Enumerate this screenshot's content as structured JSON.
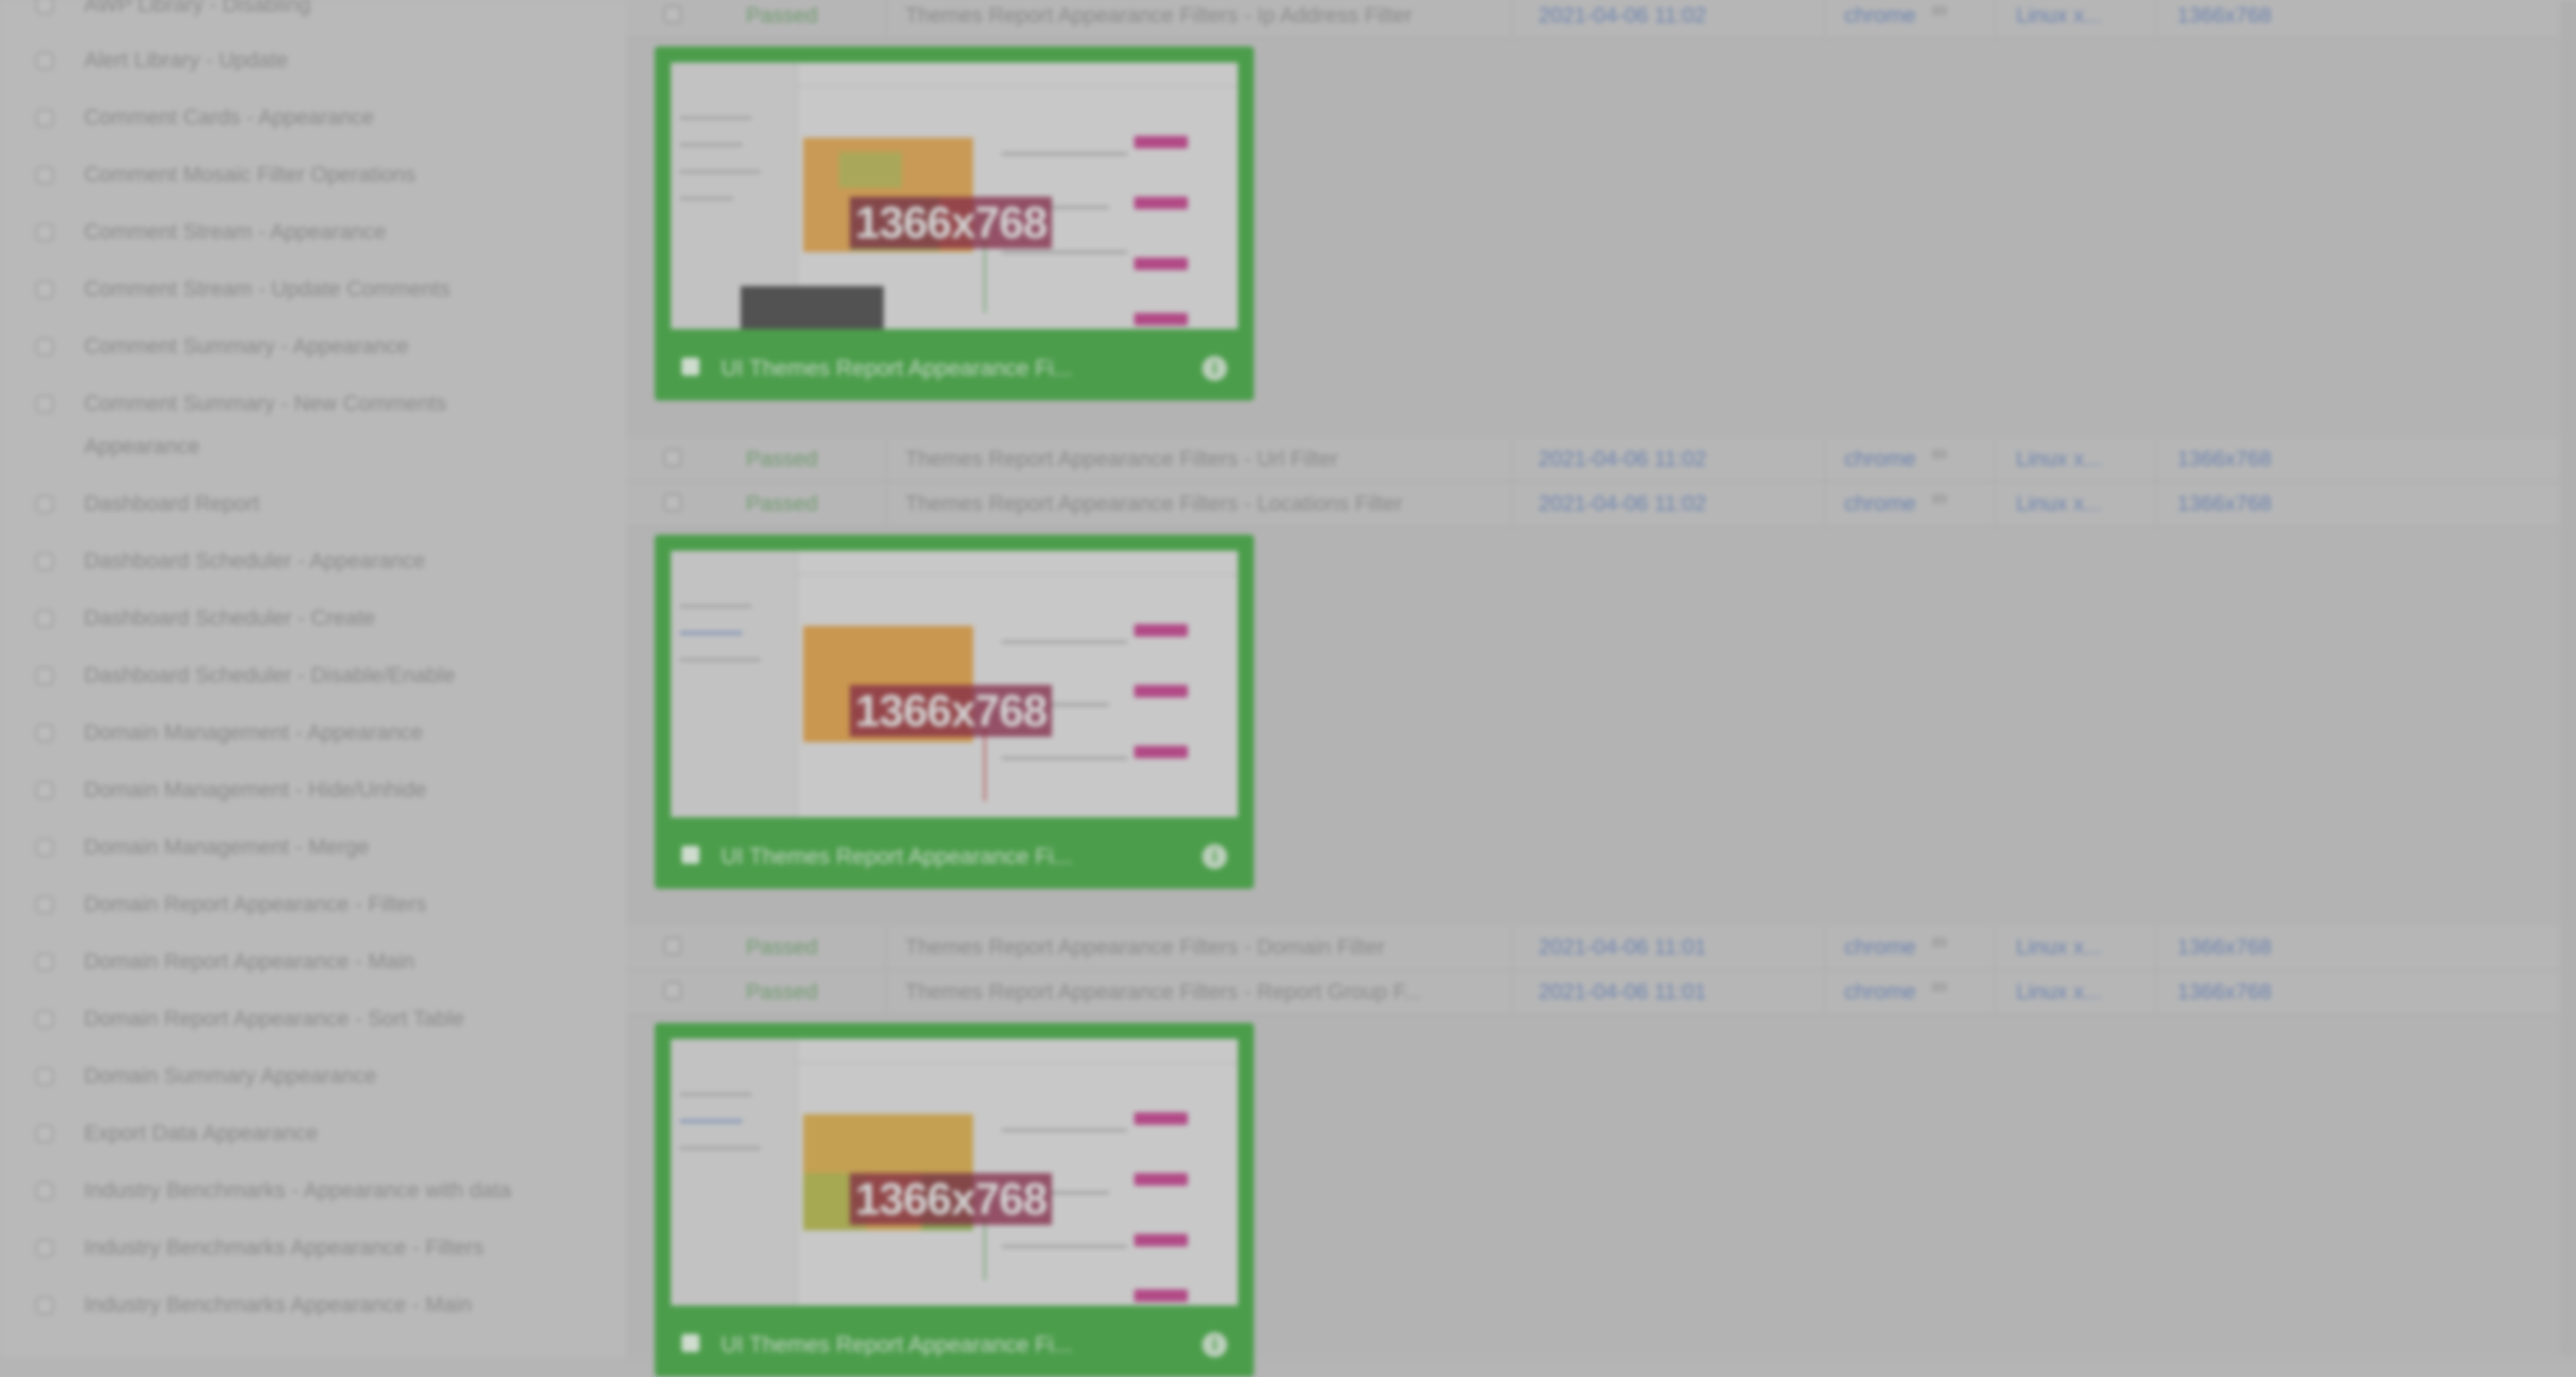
{
  "sidebar": {
    "items": [
      {
        "label": "AWP Library - Disabling"
      },
      {
        "label": "Alert Library - Update"
      },
      {
        "label": "Comment Cards - Appearance"
      },
      {
        "label": "Comment Mosaic Filter Operations"
      },
      {
        "label": "Comment Stream - Appearance"
      },
      {
        "label": "Comment Stream - Update Comments"
      },
      {
        "label": "Comment Summary - Appearance"
      },
      {
        "label": "Comment Summary - New Comments Appearance"
      },
      {
        "label": "Dashboard Report"
      },
      {
        "label": "Dashboard Scheduler - Appearance"
      },
      {
        "label": "Dashboard Scheduler - Create"
      },
      {
        "label": "Dashboard Scheduler - Disable/Enable"
      },
      {
        "label": "Domain Management - Appearance"
      },
      {
        "label": "Domain Management - Hide/Unhide"
      },
      {
        "label": "Domain Management - Merge"
      },
      {
        "label": "Domain Report Appearance - Filters"
      },
      {
        "label": "Domain Report Appearance - Main"
      },
      {
        "label": "Domain Report Appearance - Sort Table"
      },
      {
        "label": "Domain Summary Appearance"
      },
      {
        "label": "Export Data Appearance"
      },
      {
        "label": "Industry Benchmarks - Appearance with data"
      },
      {
        "label": "Industry Benchmarks Appearance - Filters"
      },
      {
        "label": "Industry Benchmarks Appearance - Main"
      }
    ]
  },
  "rows": [
    {
      "status": "Passed",
      "name": "Themes Report Appearance Filters - Ip Address Filter",
      "date": "2021-04-06 11:02",
      "browser": "chrome",
      "version": "89",
      "os": "Linux x...",
      "resolution": "1366x768"
    },
    {
      "status": "Passed",
      "name": "Themes Report Appearance Filters - Url Filter",
      "date": "2021-04-06 11:02",
      "browser": "chrome",
      "version": "89",
      "os": "Linux x...",
      "resolution": "1366x768"
    },
    {
      "status": "Passed",
      "name": "Themes Report Appearance Filters - Locations Filter",
      "date": "2021-04-06 11:02",
      "browser": "chrome",
      "version": "89",
      "os": "Linux x...",
      "resolution": "1366x768"
    },
    {
      "status": "Passed",
      "name": "Themes Report Appearance Filters - Domain Filter",
      "date": "2021-04-06 11:01",
      "browser": "chrome",
      "version": "89",
      "os": "Linux x...",
      "resolution": "1366x768"
    },
    {
      "status": "Passed",
      "name": "Themes Report Appearance Filters - Report Group F...",
      "date": "2021-04-06 11:01",
      "browser": "chrome",
      "version": "89",
      "os": "Linux x...",
      "resolution": "1366x768"
    }
  ],
  "cards": [
    {
      "title": "UI Themes Report Appearance Fi...",
      "resolution": "1366x768",
      "info": "i"
    },
    {
      "title": "UI Themes Report Appearance Fi...",
      "resolution": "1366x768",
      "info": "i"
    },
    {
      "title": "UI Themes Report Appearance Fi...",
      "resolution": "1366x768",
      "info": "i"
    }
  ],
  "colors": {
    "card": "#4b9d4b",
    "passed": "#6f9a6f",
    "link": "#6c84b0",
    "overlay": "#b5b5b5"
  }
}
